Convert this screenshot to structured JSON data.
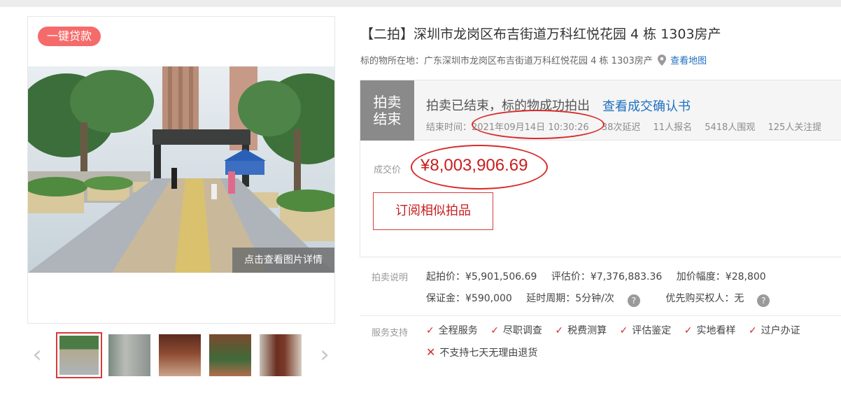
{
  "gallery": {
    "loan_badge": "一键贷款",
    "photo_detail_label": "点击查看图片详情",
    "thumbnails": [
      {
        "name": "thumbnail-1",
        "active": true
      },
      {
        "name": "thumbnail-2",
        "active": false
      },
      {
        "name": "thumbnail-3",
        "active": false
      },
      {
        "name": "thumbnail-4",
        "active": false
      },
      {
        "name": "thumbnail-5",
        "active": false
      }
    ],
    "prev_arrow": "‹",
    "next_arrow": "›"
  },
  "item": {
    "title": "【二拍】深圳市龙岗区布吉街道万科红悦花园 4 栋 1303房产",
    "location_label": "标的物所在地：",
    "location_value": "广东深圳市龙岗区布吉街道万科红悦花园 4 栋 1303房产",
    "map_link": "查看地图"
  },
  "status": {
    "box_line1": "拍卖",
    "box_line2": "结束",
    "message": "拍卖已结束，标的物成功拍出",
    "confirm_link": "查看成交确认书",
    "end_time_label": "结束时间：",
    "end_time": "2021年09月14日 10:30:26",
    "delays": "38次延迟",
    "signups": "11人报名",
    "viewers": "5418人围观",
    "followers": "125人关注提"
  },
  "deal": {
    "price_label": "成交价",
    "price_value": "¥8,003,906.69",
    "subscribe_button": "订阅相似拍品"
  },
  "rules": {
    "label": "拍卖说明",
    "start_price": "起拍价：¥5,901,506.69",
    "appraisal": "评估价：¥7,376,883.36",
    "increment": "加价幅度：¥28,800",
    "deposit": "保证金：¥590,000",
    "delay_period": "延时周期：5分钟/次",
    "priority_buyer": "优先购买权人：无",
    "help_glyph": "?"
  },
  "services": {
    "label": "服务支持",
    "items": [
      "全程服务",
      "尽职调查",
      "税费测算",
      "评估鉴定",
      "实地看样",
      "过户办证"
    ],
    "not_supported": "不支持七天无理由退货",
    "check_glyph": "✓",
    "cross_glyph": "✕"
  },
  "colors": {
    "accent_red": "#c81e1e",
    "link_blue": "#1d6fc1",
    "badge_red": "#f56b6b",
    "status_gray": "#8a8a8a"
  }
}
